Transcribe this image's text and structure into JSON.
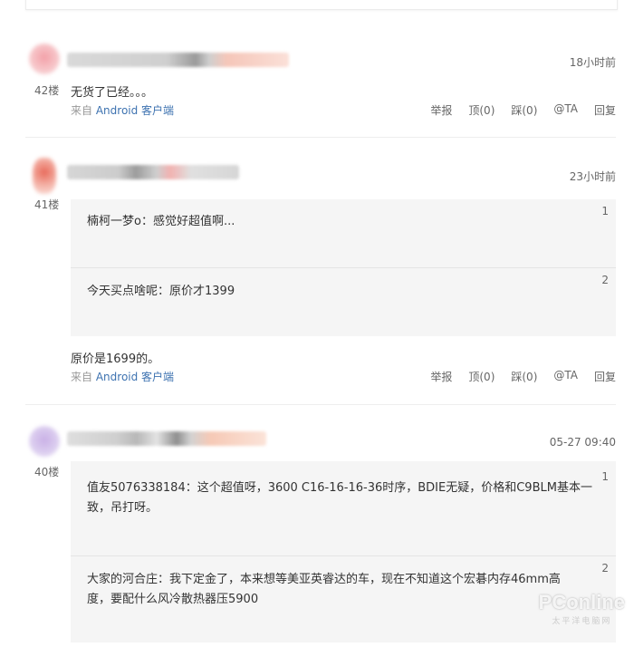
{
  "colors": {
    "link": "#3d72b0",
    "quote_bg": "#f5f5f5",
    "divider": "#eeeeee"
  },
  "comments": [
    {
      "floor": "42楼",
      "time": "18小时前",
      "content": "无货了已经。。。",
      "source_prefix": "来自",
      "source_link": "Android 客户端",
      "actions": [
        "举报",
        "顶(0)",
        "踩(0)",
        "@TA",
        "回复"
      ]
    },
    {
      "floor": "41楼",
      "time": "23小时前",
      "quotes": [
        {
          "num": "1",
          "user": "楠柯一梦o：",
          "text": "感觉好超值啊..."
        },
        {
          "num": "2",
          "user": "今天买点啥呢：",
          "text": "原价才1399"
        }
      ],
      "content": "原价是1699的。",
      "source_prefix": "来自",
      "source_link": "Android 客户端",
      "actions": [
        "举报",
        "顶(0)",
        "踩(0)",
        "@TA",
        "回复"
      ]
    },
    {
      "floor": "40楼",
      "time": "05-27 09:40",
      "quotes": [
        {
          "num": "1",
          "user": "值友5076338184：",
          "line1": "这个超值呀，3600 C16-16-16-36时序，BDIE无疑，价格和C9BLM基本一",
          "line2": "致，吊打呀。"
        },
        {
          "num": "2",
          "user": "大家的河合庄：",
          "line1": "我下定金了，本来想等美亚英睿达的车，现在不知道这个宏碁内存46mm高",
          "line2": "度，要配什么风冷散热器压5900"
        }
      ]
    }
  ],
  "watermark": {
    "main": "PConline",
    "sub": "太平洋电脑网"
  }
}
